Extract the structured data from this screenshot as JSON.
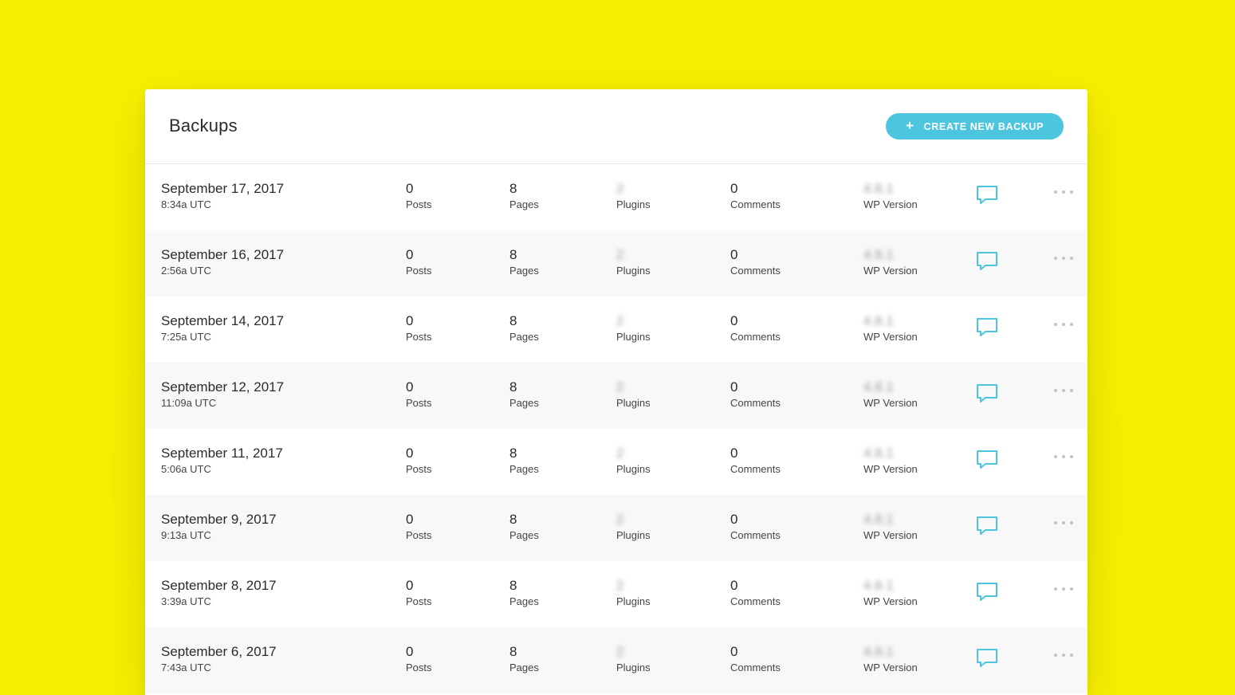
{
  "header": {
    "title": "Backups",
    "create_button_label": "CREATE NEW BACKUP",
    "create_button_icon": "plus-icon"
  },
  "colors": {
    "background": "#f5ef00",
    "accent": "#4cc6de",
    "panel": "#ffffff",
    "row_alt": "#f8f8f8"
  },
  "labels": {
    "posts": "Posts",
    "pages": "Pages",
    "plugins": "Plugins",
    "comments": "Comments",
    "wp_version": "WP Version"
  },
  "backups": [
    {
      "date": "September 17, 2017",
      "time": "8:34a UTC",
      "posts": "0",
      "pages": "8",
      "plugins": "2",
      "comments": "0",
      "wp_version": "4.8.1"
    },
    {
      "date": "September 16, 2017",
      "time": "2:56a UTC",
      "posts": "0",
      "pages": "8",
      "plugins": "2",
      "comments": "0",
      "wp_version": "4.8.1"
    },
    {
      "date": "September 14, 2017",
      "time": "7:25a UTC",
      "posts": "0",
      "pages": "8",
      "plugins": "2",
      "comments": "0",
      "wp_version": "4.8.1"
    },
    {
      "date": "September 12, 2017",
      "time": "11:09a UTC",
      "posts": "0",
      "pages": "8",
      "plugins": "2",
      "comments": "0",
      "wp_version": "4.8.1"
    },
    {
      "date": "September 11, 2017",
      "time": "5:06a UTC",
      "posts": "0",
      "pages": "8",
      "plugins": "2",
      "comments": "0",
      "wp_version": "4.8.1"
    },
    {
      "date": "September 9, 2017",
      "time": "9:13a UTC",
      "posts": "0",
      "pages": "8",
      "plugins": "2",
      "comments": "0",
      "wp_version": "4.8.1"
    },
    {
      "date": "September 8, 2017",
      "time": "3:39a UTC",
      "posts": "0",
      "pages": "8",
      "plugins": "2",
      "comments": "0",
      "wp_version": "4.8.1"
    },
    {
      "date": "September 6, 2017",
      "time": "7:43a UTC",
      "posts": "0",
      "pages": "8",
      "plugins": "2",
      "comments": "0",
      "wp_version": "4.8.1"
    }
  ],
  "row_icons": {
    "comment": "comment-bubble-icon",
    "more": "more-options-icon"
  }
}
